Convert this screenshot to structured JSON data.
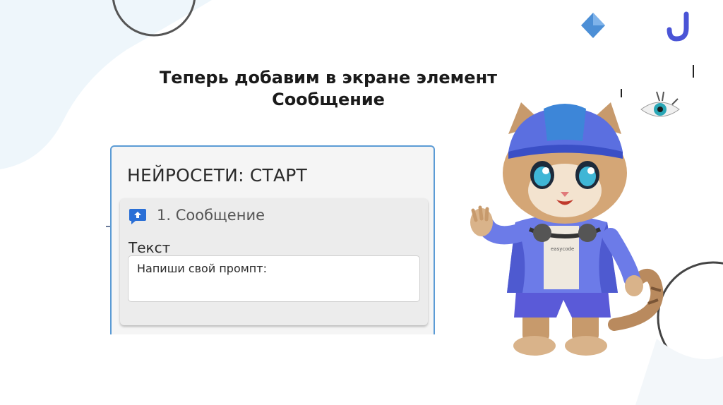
{
  "slide": {
    "title_line1": "Теперь добавим в экране элемент",
    "title_line2": "Сообщение"
  },
  "panel": {
    "title": "НЕЙРОСЕТИ: СТАРТ",
    "block": {
      "icon": "message-upload-icon",
      "label": "1. Сообщение",
      "field_label": "Текст",
      "field_value": "Напиши свой промпт:"
    }
  },
  "decorations": {
    "mascot": "cat-mascot-illustration",
    "mascot_shirt_text": "easycode"
  },
  "colors": {
    "panel_border": "#5b9bd5",
    "icon_blue": "#2a6fd6",
    "title_text": "#1a1a1a",
    "panel_bg": "#f5f5f5",
    "block_bg": "#ececec"
  }
}
